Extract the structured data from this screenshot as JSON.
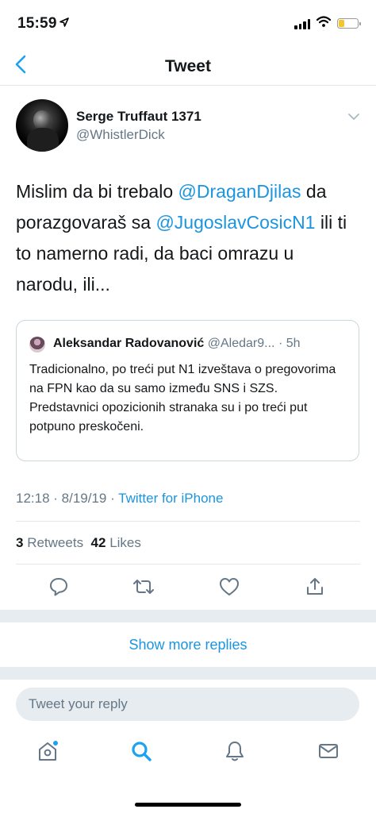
{
  "status_bar": {
    "time": "15:59",
    "icons": [
      "location-arrow-icon",
      "signal-icon",
      "wifi-icon",
      "battery-icon"
    ],
    "battery_color": "#f4c62b"
  },
  "nav": {
    "back_icon": "chevron-left-icon",
    "title": "Tweet"
  },
  "tweet": {
    "author": {
      "name": "Serge Truffaut 1371",
      "handle": "@WhistlerDick"
    },
    "text_parts": {
      "t1": "Mislim da bi trebalo ",
      "m1": "@DraganDjilas",
      "t2": " da porazgovaraš sa ",
      "m2": "@JugoslavCosicN1",
      "t3": " ili ti to namerno radi, da baci omrazu u narodu, ili..."
    },
    "quoted": {
      "name": "Aleksandar Radovanović",
      "handle": "@Aledar9...",
      "time": "· 5h",
      "body": "Tradicionalno, po treći put N1 izveštava o pregovorima na FPN kao da su samo između SNS i SZS. Predstavnici opozicionih stranaka su i po treći put potpuno preskočeni."
    },
    "timestamp": "12:18 · 8/19/19 · ",
    "source": "Twitter for iPhone",
    "stats": {
      "retweets_count": "3",
      "retweets_label": "Retweets",
      "likes_count": "42",
      "likes_label": "Likes"
    },
    "actions": [
      "reply-icon",
      "retweet-icon",
      "like-icon",
      "share-icon"
    ]
  },
  "show_more": "Show more replies",
  "reply_input": {
    "placeholder": "Tweet your reply",
    "value": ""
  },
  "tab_bar": [
    "home-icon",
    "search-icon",
    "notifications-icon",
    "messages-icon"
  ],
  "colors": {
    "accent": "#1b95e0",
    "secondary_text": "#657786",
    "primary_text": "#14171a",
    "separator": "#e6ecf0"
  }
}
